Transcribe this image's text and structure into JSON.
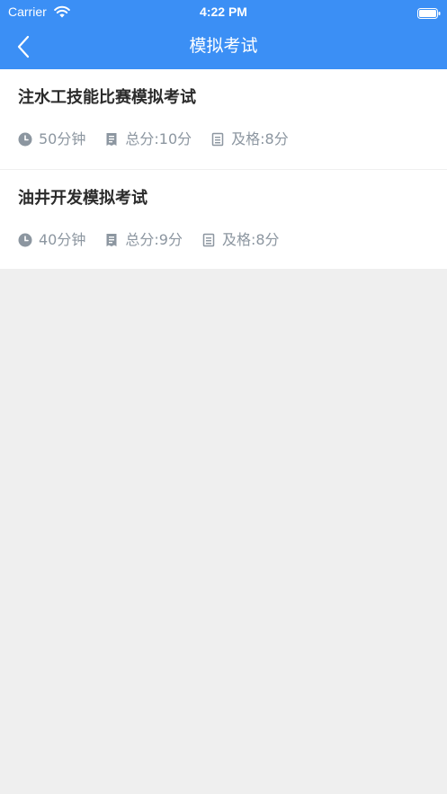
{
  "status_bar": {
    "carrier": "Carrier",
    "time": "4:22 PM"
  },
  "nav": {
    "title": "模拟考试",
    "back_icon": "chevron-left-icon"
  },
  "exams": [
    {
      "title": "注水工技能比赛模拟考试",
      "duration": "50分钟",
      "total": "总分:10分",
      "pass": "及格:8分"
    },
    {
      "title": "油井开发模拟考试",
      "duration": "40分钟",
      "total": "总分:9分",
      "pass": "及格:8分"
    }
  ],
  "colors": {
    "header": "#3b8ff5",
    "background": "#efefef",
    "meta_text": "#8c96a0",
    "title_text": "#2b2b2b"
  }
}
